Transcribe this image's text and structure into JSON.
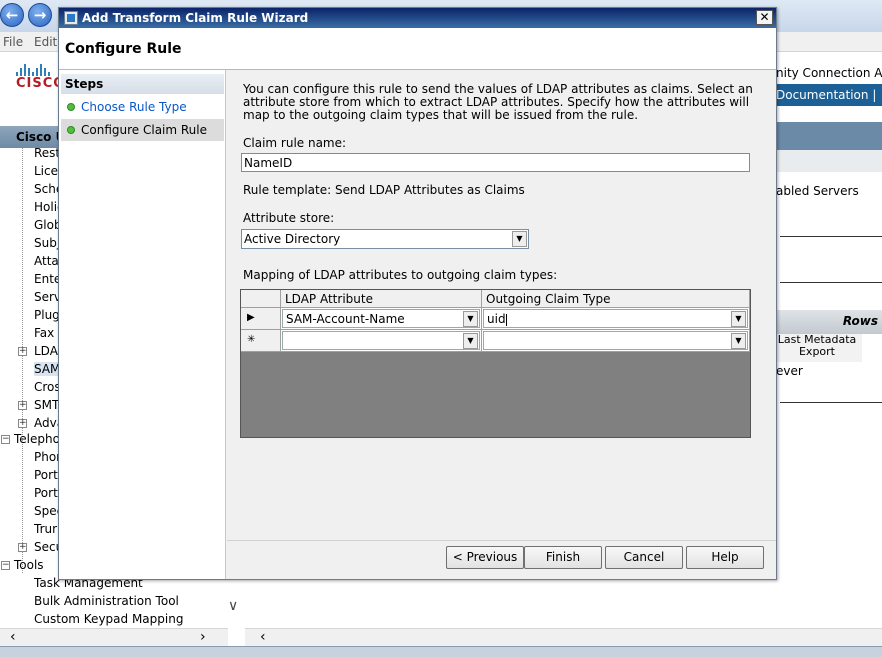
{
  "browser": {
    "menu": [
      "File",
      "Edit"
    ]
  },
  "app": {
    "logo_text": "CISCO",
    "header_right_text": "nity Connection Adr",
    "header_nav_text": "Documentation  |",
    "tree_header": "Cisco U",
    "tree_items": [
      "Rest",
      "Licer",
      "Sche",
      "Holic",
      "Glob",
      "Subj",
      "Atta",
      "Ente",
      "Serv",
      "Plug",
      "Fax",
      "LDAI",
      "SAM",
      "Cros",
      "SMT",
      "Adva"
    ],
    "telephony_root": "Telepho",
    "telephony_items": [
      "Phor",
      "Port",
      "Port",
      "Spee",
      "Trur",
      "Secu"
    ],
    "tools_root": "Tools",
    "tools_items": [
      "Task Management",
      "Bulk Administration Tool",
      "Custom Keypad Mapping"
    ],
    "right_panel": {
      "servers_label": "abled Servers",
      "rows_label": "Rows",
      "col_header": "Last Metadata Export",
      "cell_value": "ever"
    }
  },
  "dialog": {
    "title": "Add Transform Claim Rule Wizard",
    "close_glyph": "✕",
    "heading": "Configure Rule",
    "steps_header": "Steps",
    "steps": [
      {
        "label": "Choose Rule Type",
        "link": true
      },
      {
        "label": "Configure Claim Rule",
        "link": false
      }
    ],
    "description": "You can configure this rule to send the values of LDAP attributes as claims. Select an attribute store from which to extract LDAP attributes. Specify how the attributes will map to the outgoing claim types that will be issued from the rule.",
    "claim_rule_name_label": "Claim rule name:",
    "claim_rule_name_value": "NameID",
    "rule_template_text": "Rule template: Send LDAP Attributes as Claims",
    "attribute_store_label": "Attribute store:",
    "attribute_store_value": "Active Directory",
    "mapping_label": "Mapping of LDAP attributes to outgoing claim types:",
    "grid": {
      "columns": [
        "LDAP Attribute",
        "Outgoing Claim Type"
      ],
      "rows": [
        {
          "marker": "▶",
          "ldap": "SAM-Account-Name",
          "claim": "uid"
        },
        {
          "marker": "✳",
          "ldap": "",
          "claim": ""
        }
      ]
    },
    "buttons": {
      "previous": "< Previous",
      "finish": "Finish",
      "cancel": "Cancel",
      "help": "Help"
    }
  }
}
